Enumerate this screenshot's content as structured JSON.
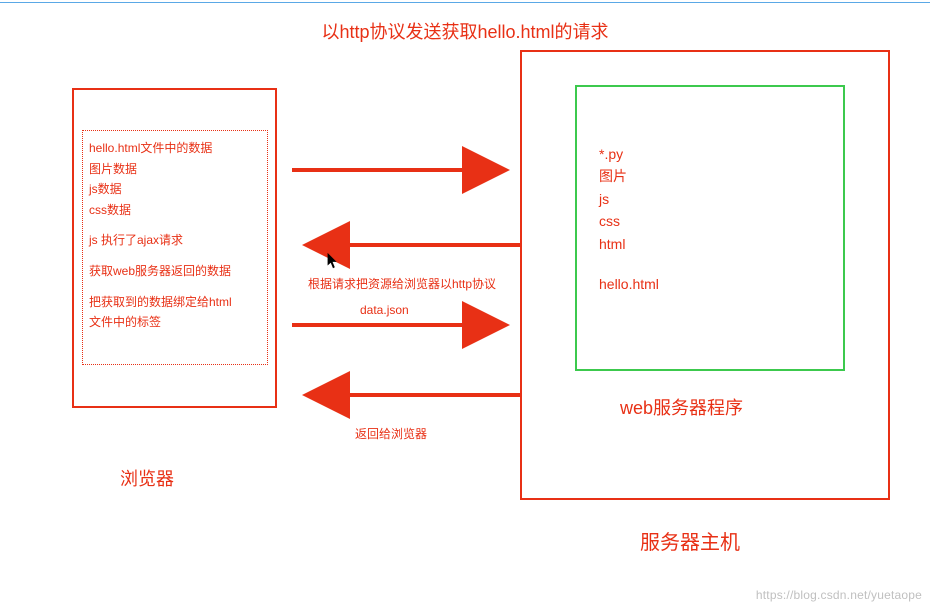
{
  "title": "以http协议发送获取hello.html的请求",
  "browser": {
    "lines": [
      "hello.html文件中的数据",
      "图片数据",
      "js数据",
      "css数据"
    ],
    "ajax_line": "js 执行了ajax请求",
    "recv_line": "获取web服务器返回的数据",
    "bind_line1": "把获取到的数据绑定给html",
    "bind_line2": "文件中的标签",
    "label": "浏览器"
  },
  "arrows": {
    "resp_label": "根据请求把资源给浏览器以http协议",
    "data_json": "data.json",
    "return_label": "返回给浏览器"
  },
  "server": {
    "files": [
      "*.py",
      "图片",
      "js",
      "css",
      "html"
    ],
    "hello": "hello.html",
    "web_label": "web服务器程序",
    "host_label": "服务器主机"
  },
  "watermark": "https://blog.csdn.net/yuetaope"
}
